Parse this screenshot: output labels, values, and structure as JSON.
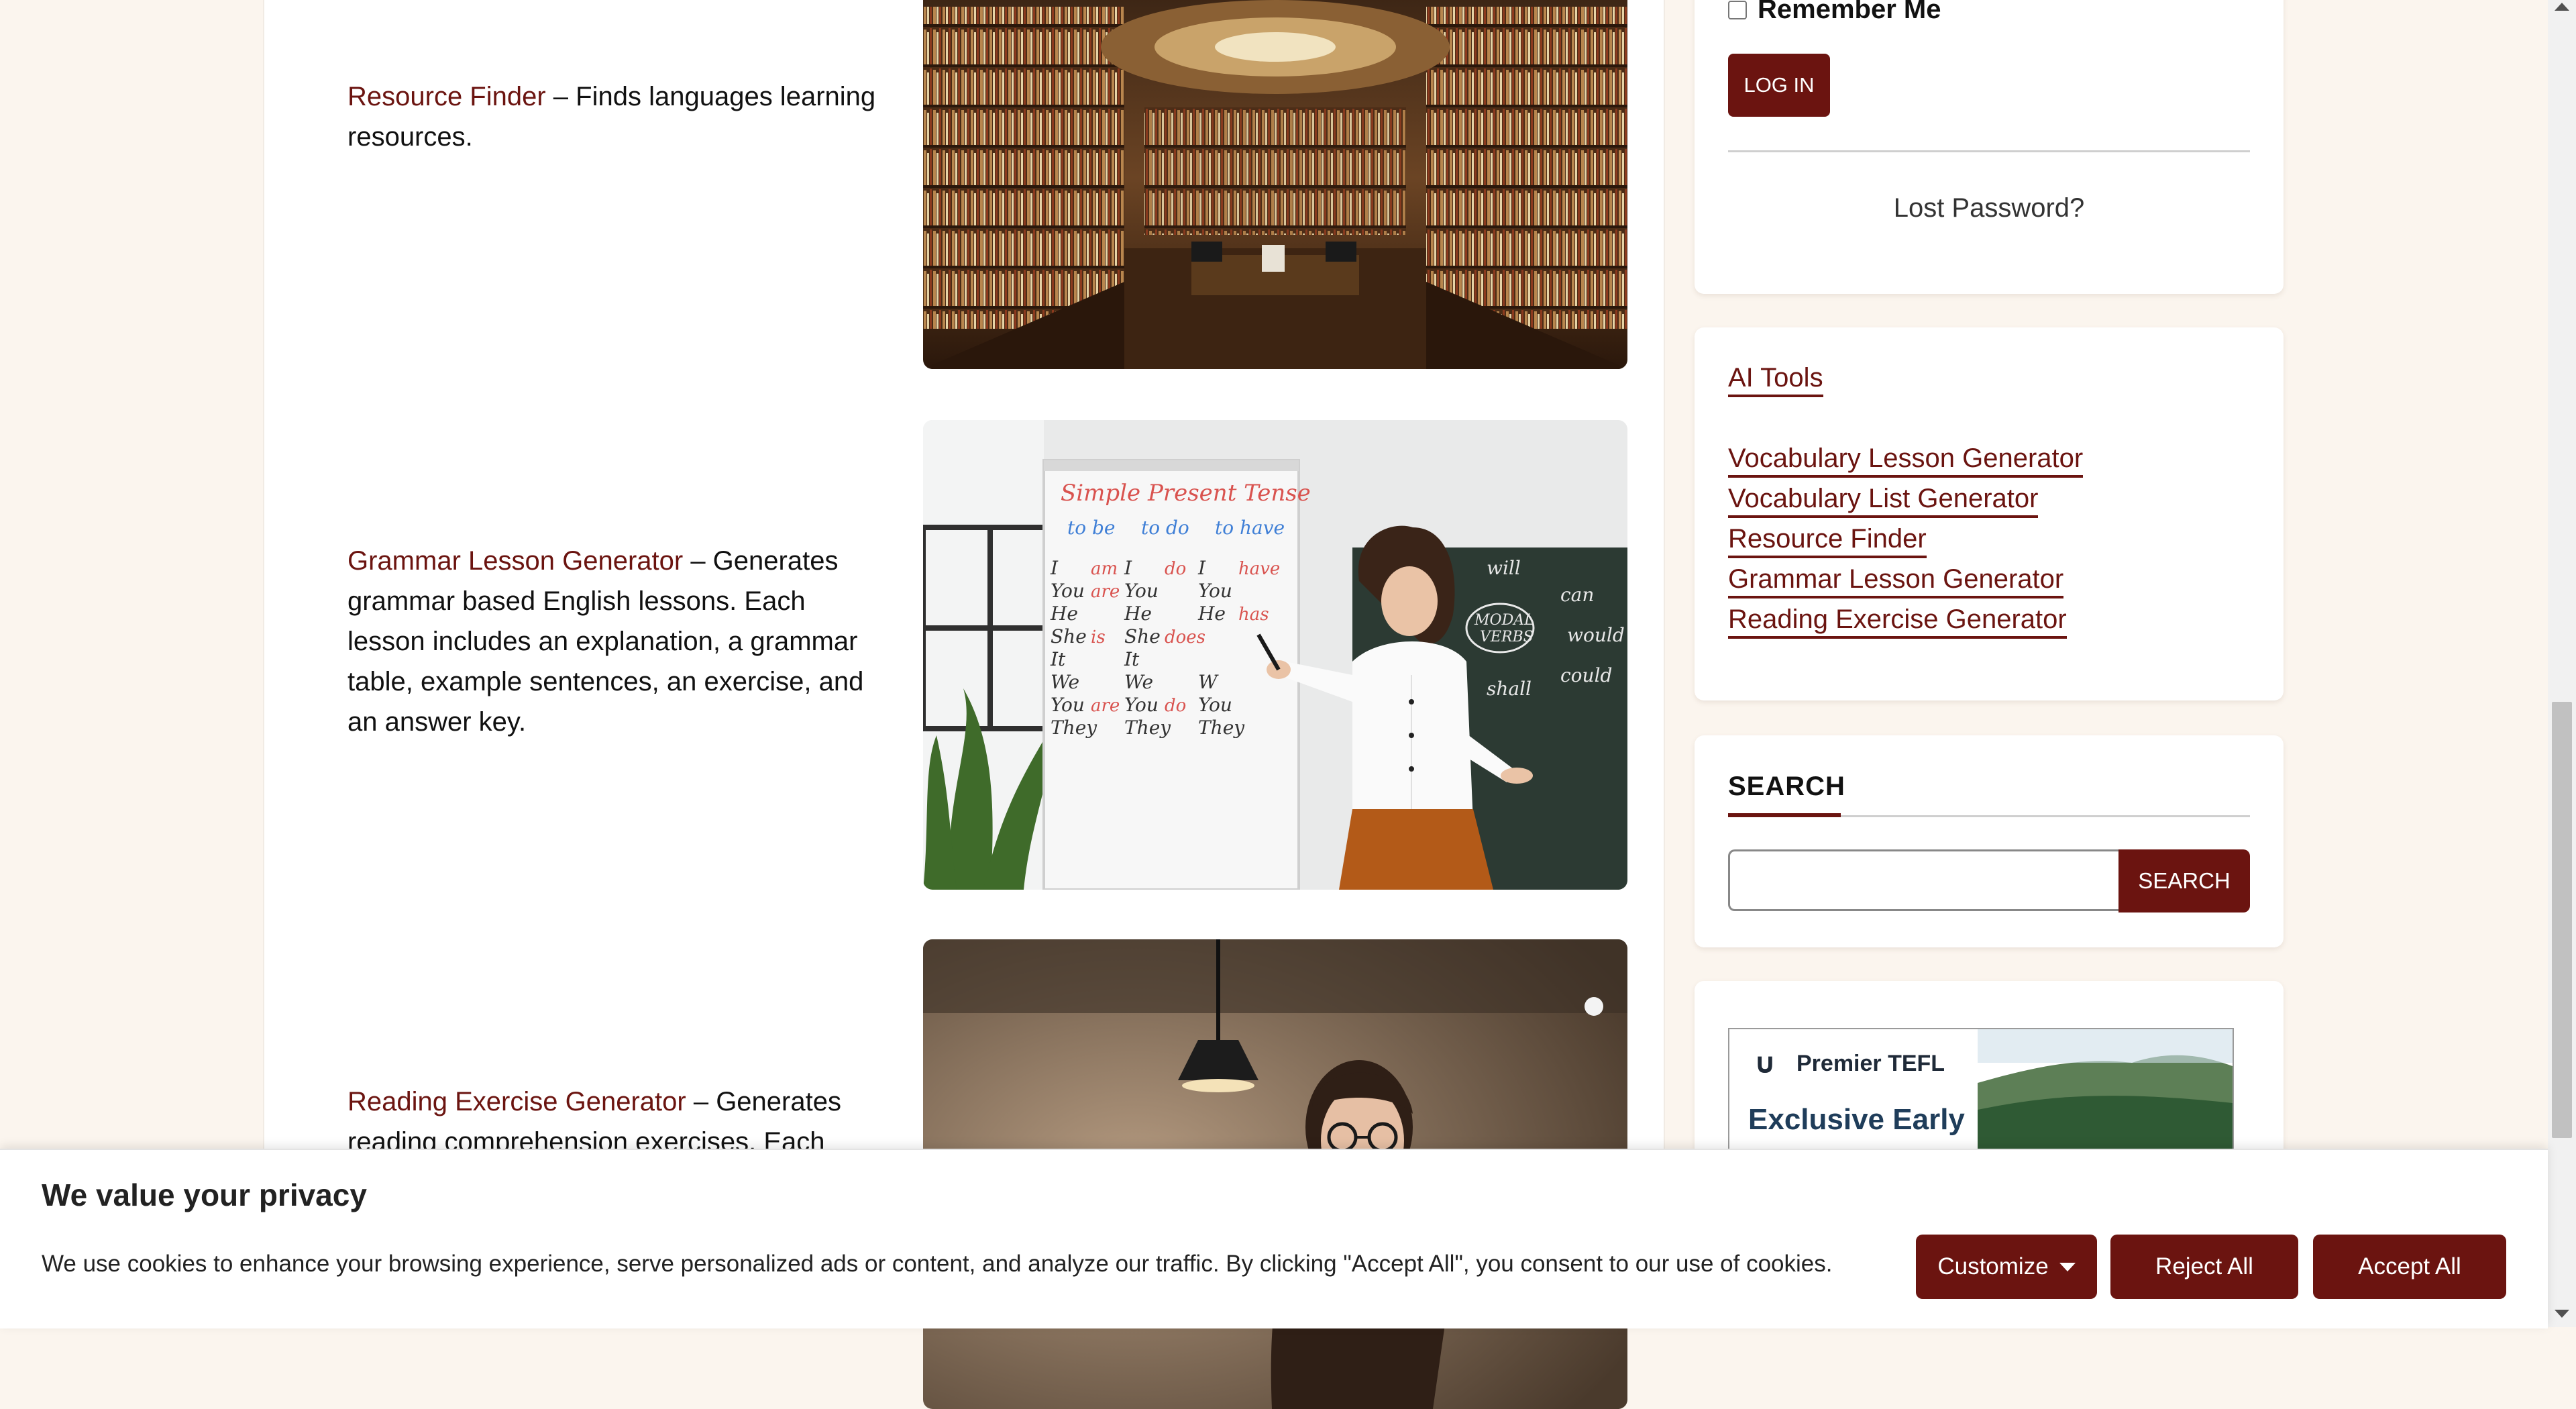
{
  "main": {
    "entries": [
      {
        "link": "Resource Finder",
        "text": " – Finds languages learning resources."
      },
      {
        "link": "Grammar Lesson Generator",
        "text": " – Generates grammar based English lessons. Each lesson includes an explanation, a grammar table, example sentences, an exercise, and an answer key."
      },
      {
        "link": "Reading Exercise Generator",
        "text": " – Generates reading comprehension exercises. Each"
      }
    ],
    "whiteboard": {
      "title": "Simple Present Tense",
      "heads": [
        "to be",
        "to do",
        "to have"
      ],
      "col1": [
        "I",
        "You",
        "He",
        "She",
        "It",
        "We",
        "You",
        "They"
      ],
      "col1_verbs": [
        "am",
        "are",
        "",
        "is",
        "",
        "",
        "are",
        ""
      ],
      "col2": [
        "I",
        "You",
        "He",
        "She",
        "It",
        "We",
        "You",
        "They"
      ],
      "col2_verbs": [
        "do",
        "",
        "",
        "does",
        "",
        "",
        "do",
        ""
      ],
      "col3": [
        "I",
        "You",
        "He",
        "",
        "",
        "W",
        "You",
        "They"
      ],
      "col3_verbs": [
        "have",
        "",
        "has",
        "",
        "",
        "",
        "",
        ""
      ]
    },
    "chalkboard": {
      "center": "MODAL VERBS",
      "words": [
        "would",
        "will",
        "can",
        "would",
        "could",
        "shall"
      ]
    }
  },
  "sidebar": {
    "login": {
      "remember_label": "Remember Me",
      "login_button": "LOG IN",
      "lost_password": "Lost Password?"
    },
    "tools": {
      "title": "AI Tools",
      "links": [
        "Vocabulary Lesson Generator",
        "Vocabulary List Generator",
        "Resource Finder",
        "Grammar Lesson Generator",
        "Reading Exercise Generator"
      ]
    },
    "search": {
      "title": "SEARCH",
      "button": "SEARCH",
      "placeholder": ""
    },
    "ad": {
      "brand": "Premier TEFL",
      "headline": "Exclusive Early"
    }
  },
  "cookie": {
    "title": "We value your privacy",
    "text": "We use cookies to enhance your browsing experience, serve personalized ads or content, and analyze our traffic. By clicking \"Accept All\", you consent to our use of cookies.",
    "customize": "Customize",
    "reject": "Reject All",
    "accept": "Accept All"
  },
  "colors": {
    "accent": "#6b1410",
    "page_bg": "#fbf5ee",
    "panel_bg": "#ffffff"
  }
}
